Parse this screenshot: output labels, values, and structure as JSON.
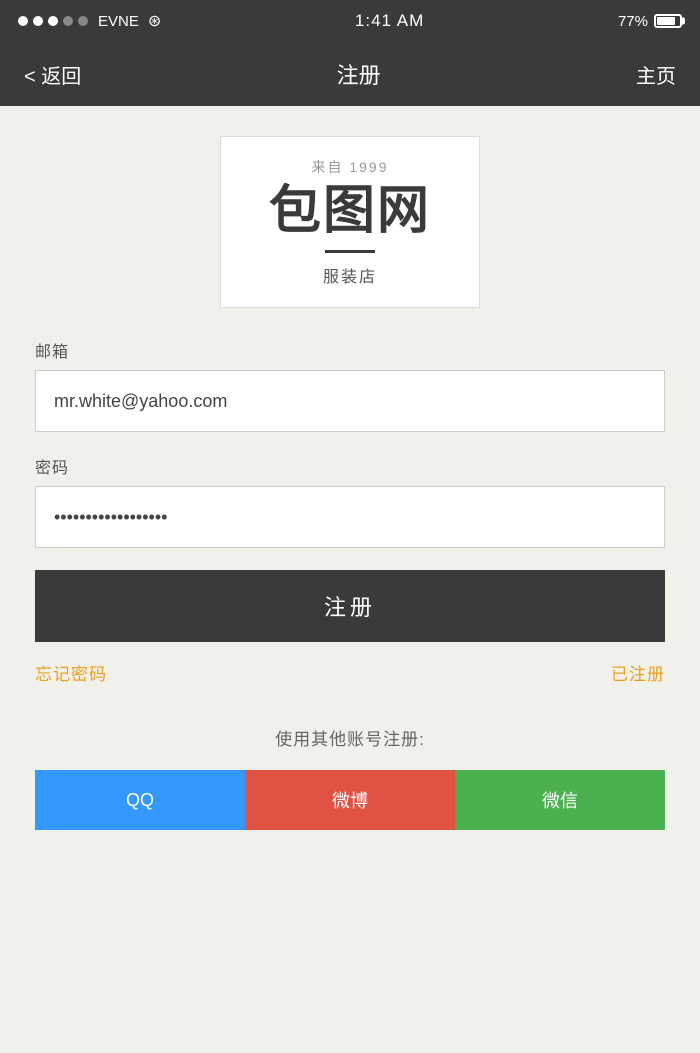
{
  "statusBar": {
    "carrier": "EVNE",
    "time": "1:41 AM",
    "battery": "77%",
    "dots": [
      "filled",
      "filled",
      "filled",
      "empty",
      "empty"
    ]
  },
  "navBar": {
    "back_label": "< 返回",
    "title": "注册",
    "home_label": "主页"
  },
  "logoCard": {
    "subtitle": "来自 1999",
    "title": "包图网",
    "tagline": "服装店"
  },
  "form": {
    "email_label": "邮箱",
    "email_value": "mr.white@yahoo.com",
    "email_placeholder": "mr.white@yahoo.com",
    "password_label": "密码",
    "password_value": "••••••••••••••••",
    "password_placeholder": ""
  },
  "buttons": {
    "register_label": "注册",
    "forgot_label": "忘记密码",
    "already_label": "已注册"
  },
  "social": {
    "label": "使用其他账号注册:",
    "btn_qq": "QQ",
    "btn_weibo": "微博",
    "btn_wechat": "微信"
  }
}
